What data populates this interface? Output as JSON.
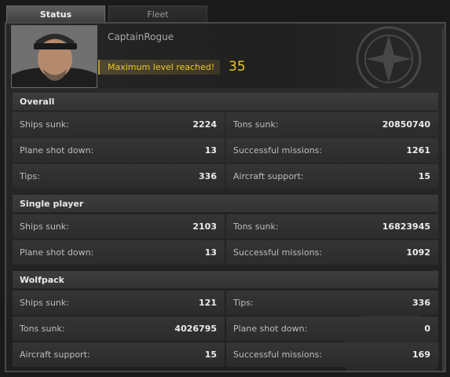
{
  "tabs": [
    {
      "label": "Status",
      "active": true
    },
    {
      "label": "Fleet",
      "active": false
    }
  ],
  "profile": {
    "name": "CaptainRogue",
    "level_text": "Maximum level reached!",
    "level": "35"
  },
  "sections": [
    {
      "title": "Overall",
      "rows": [
        [
          {
            "label": "Ships sunk:",
            "value": "2224"
          },
          {
            "label": "Tons sunk:",
            "value": "20850740"
          }
        ],
        [
          {
            "label": "Plane shot down:",
            "value": "13"
          },
          {
            "label": "Successful missions:",
            "value": "1261"
          }
        ],
        [
          {
            "label": "Tips:",
            "value": "336"
          },
          {
            "label": "Aircraft support:",
            "value": "15"
          }
        ]
      ]
    },
    {
      "title": "Single player",
      "rows": [
        [
          {
            "label": "Ships sunk:",
            "value": "2103"
          },
          {
            "label": "Tons sunk:",
            "value": "16823945"
          }
        ],
        [
          {
            "label": "Plane shot down:",
            "value": "13"
          },
          {
            "label": "Successful missions:",
            "value": "1092"
          }
        ]
      ]
    },
    {
      "title": "Wolfpack",
      "rows": [
        [
          {
            "label": "Ships sunk:",
            "value": "121"
          },
          {
            "label": "Tips:",
            "value": "336"
          }
        ],
        [
          {
            "label": "Tons sunk:",
            "value": "4026795"
          },
          {
            "label": "Plane shot down:",
            "value": "0"
          }
        ],
        [
          {
            "label": "Aircraft support:",
            "value": "15"
          },
          {
            "label": "Successful missions:",
            "value": "169"
          }
        ]
      ]
    }
  ],
  "colors": {
    "accent_gold": "#f0c820",
    "panel_bg": "#2b2b2b",
    "cell_bg": "#353535"
  }
}
